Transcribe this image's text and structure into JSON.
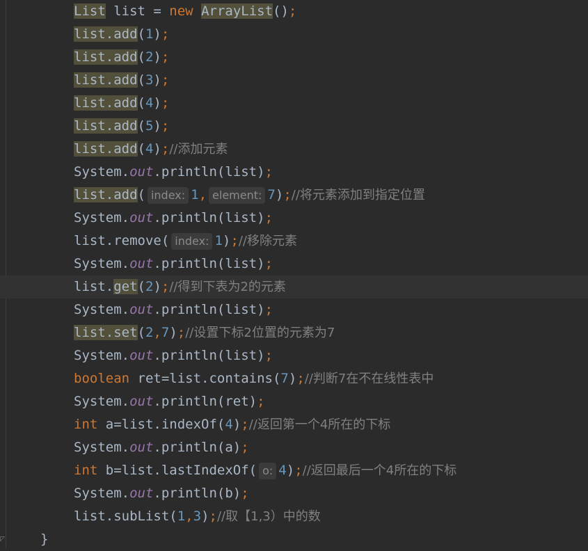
{
  "editor": {
    "lines": [
      {
        "segments": [
          {
            "t": "List",
            "c": "hl"
          },
          {
            "t": " list = "
          },
          {
            "t": "new",
            "c": "kw"
          },
          {
            "t": " "
          },
          {
            "t": "ArrayList",
            "c": "hl"
          },
          {
            "t": "()"
          },
          {
            "t": ";",
            "c": "kw"
          }
        ]
      },
      {
        "segments": [
          {
            "t": "list.add",
            "c": "hl"
          },
          {
            "t": "("
          },
          {
            "t": "1",
            "c": "num"
          },
          {
            "t": ")"
          },
          {
            "t": ";",
            "c": "kw"
          }
        ]
      },
      {
        "segments": [
          {
            "t": "list.add",
            "c": "hl"
          },
          {
            "t": "("
          },
          {
            "t": "2",
            "c": "num"
          },
          {
            "t": ")"
          },
          {
            "t": ";",
            "c": "kw"
          }
        ]
      },
      {
        "segments": [
          {
            "t": "list.add",
            "c": "hl"
          },
          {
            "t": "("
          },
          {
            "t": "3",
            "c": "num"
          },
          {
            "t": ")"
          },
          {
            "t": ";",
            "c": "kw"
          }
        ]
      },
      {
        "segments": [
          {
            "t": "list.add",
            "c": "hl"
          },
          {
            "t": "("
          },
          {
            "t": "4",
            "c": "num"
          },
          {
            "t": ")"
          },
          {
            "t": ";",
            "c": "kw"
          }
        ]
      },
      {
        "segments": [
          {
            "t": "list.add",
            "c": "hl"
          },
          {
            "t": "("
          },
          {
            "t": "5",
            "c": "num"
          },
          {
            "t": ")"
          },
          {
            "t": ";",
            "c": "kw"
          }
        ]
      },
      {
        "segments": [
          {
            "t": "list.add",
            "c": "hl"
          },
          {
            "t": "("
          },
          {
            "t": "4",
            "c": "num"
          },
          {
            "t": ")"
          },
          {
            "t": ";",
            "c": "kw"
          },
          {
            "t": "//添加元素",
            "c": "comment"
          }
        ]
      },
      {
        "segments": [
          {
            "t": "System."
          },
          {
            "t": "out",
            "c": "field"
          },
          {
            "t": ".println(list)"
          },
          {
            "t": ";",
            "c": "kw"
          }
        ]
      },
      {
        "segments": [
          {
            "t": "list.add",
            "c": "hl"
          },
          {
            "t": "("
          },
          {
            "t": "index:",
            "c": "hint"
          },
          {
            "t": "1",
            "c": "num"
          },
          {
            "t": ",",
            "c": "kw"
          },
          {
            "t": "element:",
            "c": "hint"
          },
          {
            "t": "7",
            "c": "num"
          },
          {
            "t": ")"
          },
          {
            "t": ";",
            "c": "kw"
          },
          {
            "t": "//将元素添加到指定位置",
            "c": "comment"
          }
        ]
      },
      {
        "segments": [
          {
            "t": "System."
          },
          {
            "t": "out",
            "c": "field"
          },
          {
            "t": ".println(list)"
          },
          {
            "t": ";",
            "c": "kw"
          }
        ]
      },
      {
        "segments": [
          {
            "t": "list.remove("
          },
          {
            "t": "index:",
            "c": "hint"
          },
          {
            "t": "1",
            "c": "num"
          },
          {
            "t": ")"
          },
          {
            "t": ";",
            "c": "kw"
          },
          {
            "t": "//移除元素",
            "c": "comment"
          }
        ]
      },
      {
        "segments": [
          {
            "t": "System."
          },
          {
            "t": "out",
            "c": "field"
          },
          {
            "t": ".println(list)"
          },
          {
            "t": ";",
            "c": "kw"
          }
        ]
      },
      {
        "current": true,
        "segments": [
          {
            "t": "list."
          },
          {
            "t": "get",
            "c": "hl"
          },
          {
            "t": "("
          },
          {
            "t": "2",
            "c": "num"
          },
          {
            "t": ")"
          },
          {
            "t": ";",
            "c": "kw"
          },
          {
            "t": "//得到下表为2的元素",
            "c": "comment"
          }
        ]
      },
      {
        "segments": [
          {
            "t": "System."
          },
          {
            "t": "out",
            "c": "field"
          },
          {
            "t": ".println(list)"
          },
          {
            "t": ";",
            "c": "kw"
          }
        ]
      },
      {
        "segments": [
          {
            "t": "list.set",
            "c": "hl"
          },
          {
            "t": "("
          },
          {
            "t": "2",
            "c": "num"
          },
          {
            "t": ",",
            "c": "kw"
          },
          {
            "t": "7",
            "c": "num"
          },
          {
            "t": ")"
          },
          {
            "t": ";",
            "c": "kw"
          },
          {
            "t": "//设置下标2位置的元素为7",
            "c": "comment"
          }
        ]
      },
      {
        "segments": [
          {
            "t": "System."
          },
          {
            "t": "out",
            "c": "field"
          },
          {
            "t": ".println(list)"
          },
          {
            "t": ";",
            "c": "kw"
          }
        ]
      },
      {
        "segments": [
          {
            "t": "boolean",
            "c": "kw"
          },
          {
            "t": " ret=list.contains("
          },
          {
            "t": "7",
            "c": "num"
          },
          {
            "t": ")"
          },
          {
            "t": ";",
            "c": "kw"
          },
          {
            "t": "//判断7在不在线性表中",
            "c": "comment"
          }
        ]
      },
      {
        "segments": [
          {
            "t": "System."
          },
          {
            "t": "out",
            "c": "field"
          },
          {
            "t": ".println(ret)"
          },
          {
            "t": ";",
            "c": "kw"
          }
        ]
      },
      {
        "segments": [
          {
            "t": "int",
            "c": "kw"
          },
          {
            "t": " a=list.indexOf("
          },
          {
            "t": "4",
            "c": "num"
          },
          {
            "t": ")"
          },
          {
            "t": ";",
            "c": "kw"
          },
          {
            "t": "//返回第一个4所在的下标",
            "c": "comment"
          }
        ]
      },
      {
        "segments": [
          {
            "t": "System."
          },
          {
            "t": "out",
            "c": "field"
          },
          {
            "t": ".println(a)"
          },
          {
            "t": ";",
            "c": "kw"
          }
        ]
      },
      {
        "segments": [
          {
            "t": "int",
            "c": "kw"
          },
          {
            "t": " b=list.lastIndexOf("
          },
          {
            "t": "o:",
            "c": "hint"
          },
          {
            "t": "4",
            "c": "num"
          },
          {
            "t": ")"
          },
          {
            "t": ";",
            "c": "kw"
          },
          {
            "t": "//返回最后一个4所在的下标",
            "c": "comment"
          }
        ]
      },
      {
        "segments": [
          {
            "t": "System."
          },
          {
            "t": "out",
            "c": "field"
          },
          {
            "t": ".println(b)"
          },
          {
            "t": ";",
            "c": "kw"
          }
        ]
      },
      {
        "segments": [
          {
            "t": "list.subList("
          },
          {
            "t": "1",
            "c": "num"
          },
          {
            "t": ",",
            "c": "kw"
          },
          {
            "t": "3",
            "c": "num"
          },
          {
            "t": ")"
          },
          {
            "t": ";",
            "c": "kw"
          },
          {
            "t": "//取【1,3）中的数",
            "c": "comment"
          }
        ]
      },
      {
        "closing": true,
        "segments": [
          {
            "t": "}"
          }
        ]
      }
    ]
  }
}
